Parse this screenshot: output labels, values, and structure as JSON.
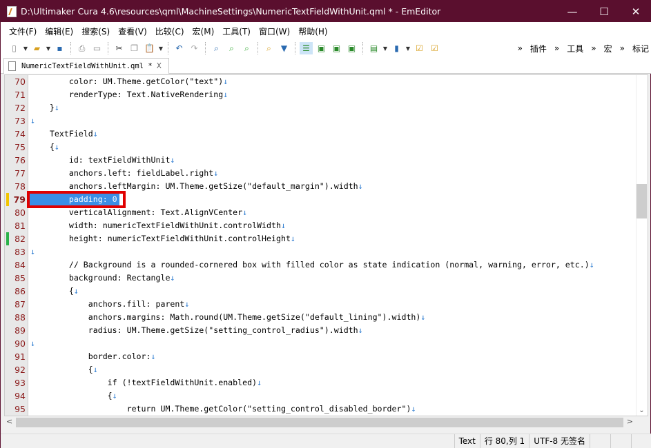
{
  "window": {
    "title": "D:\\Ultimaker Cura 4.6\\resources\\qml\\MachineSettings\\NumericTextFieldWithUnit.qml * - EmEditor",
    "minimize": "—",
    "maximize": "☐",
    "close": "✕"
  },
  "menu": [
    "文件(F)",
    "编辑(E)",
    "搜索(S)",
    "查看(V)",
    "比较(C)",
    "宏(M)",
    "工具(T)",
    "窗口(W)",
    "帮助(H)"
  ],
  "toolbar": {
    "more": "»",
    "plugins": "插件",
    "tools": "工具",
    "macro": "宏",
    "bookmark": "标记"
  },
  "tab": {
    "label": "NumericTextFieldWithUnit.qml *",
    "close": "X"
  },
  "lines": [
    {
      "n": "70",
      "t": "        color: UM.Theme.getColor(\"text\")"
    },
    {
      "n": "71",
      "t": "        renderType: Text.NativeRendering"
    },
    {
      "n": "72",
      "t": "    }"
    },
    {
      "n": "73",
      "t": ""
    },
    {
      "n": "74",
      "t": "    TextField"
    },
    {
      "n": "75",
      "t": "    {"
    },
    {
      "n": "76",
      "t": "        id: textFieldWithUnit"
    },
    {
      "n": "77",
      "t": "        anchors.left: fieldLabel.right"
    },
    {
      "n": "78",
      "t": "        anchors.leftMargin: UM.Theme.getSize(\"default_margin\").width"
    },
    {
      "n": "79",
      "t": "        padding: 0"
    },
    {
      "n": "80",
      "t": "        verticalAlignment: Text.AlignVCenter"
    },
    {
      "n": "81",
      "t": "        width: numericTextFieldWithUnit.controlWidth"
    },
    {
      "n": "82",
      "t": "        height: numericTextFieldWithUnit.controlHeight"
    },
    {
      "n": "83",
      "t": ""
    },
    {
      "n": "84",
      "t": "        // Background is a rounded-cornered box with filled color as state indication (normal, warning, error, etc.)"
    },
    {
      "n": "85",
      "t": "        background: Rectangle"
    },
    {
      "n": "86",
      "t": "        {"
    },
    {
      "n": "87",
      "t": "            anchors.fill: parent"
    },
    {
      "n": "88",
      "t": "            anchors.margins: Math.round(UM.Theme.getSize(\"default_lining\").width)"
    },
    {
      "n": "89",
      "t": "            radius: UM.Theme.getSize(\"setting_control_radius\").width"
    },
    {
      "n": "90",
      "t": ""
    },
    {
      "n": "91",
      "t": "            border.color:"
    },
    {
      "n": "92",
      "t": "            {"
    },
    {
      "n": "93",
      "t": "                if (!textFieldWithUnit.enabled)"
    },
    {
      "n": "94",
      "t": "                {"
    },
    {
      "n": "95",
      "t": "                    return UM.Theme.getColor(\"setting_control_disabled_border\")"
    },
    {
      "n": "",
      "t": "                }"
    }
  ],
  "newline_glyph": "↓",
  "current_line": "79",
  "status": {
    "mode": "Text",
    "position": "行 80,列 1",
    "encoding": "UTF-8 无签名"
  },
  "colors": {
    "titlebar": "#5a0f2e",
    "selection": "#3a8ee6",
    "highlight_box": "#e00000",
    "line_number": "#8b1a1a"
  }
}
